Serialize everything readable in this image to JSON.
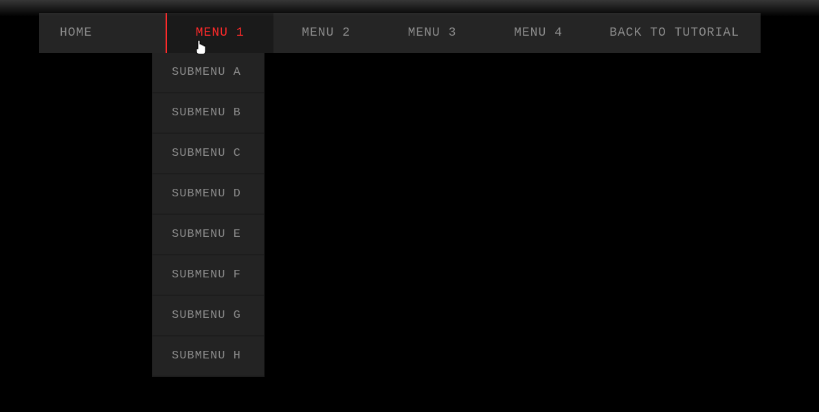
{
  "nav": {
    "items": [
      {
        "label": "HOME",
        "name": "nav-home",
        "cls": "home"
      },
      {
        "label": "MENU 1",
        "name": "nav-menu-1",
        "cls": "active"
      },
      {
        "label": "MENU 2",
        "name": "nav-menu-2",
        "cls": ""
      },
      {
        "label": "MENU 3",
        "name": "nav-menu-3",
        "cls": ""
      },
      {
        "label": "MENU 4",
        "name": "nav-menu-4",
        "cls": ""
      },
      {
        "label": "BACK TO TUTORIAL",
        "name": "nav-back-to-tutorial",
        "cls": "back"
      }
    ]
  },
  "dropdown": {
    "items": [
      {
        "label": "SUBMENU A",
        "name": "submenu-a"
      },
      {
        "label": "SUBMENU B",
        "name": "submenu-b"
      },
      {
        "label": "SUBMENU C",
        "name": "submenu-c"
      },
      {
        "label": "SUBMENU D",
        "name": "submenu-d"
      },
      {
        "label": "SUBMENU E",
        "name": "submenu-e"
      },
      {
        "label": "SUBMENU F",
        "name": "submenu-f"
      },
      {
        "label": "SUBMENU G",
        "name": "submenu-g"
      },
      {
        "label": "SUBMENU H",
        "name": "submenu-h"
      }
    ]
  }
}
